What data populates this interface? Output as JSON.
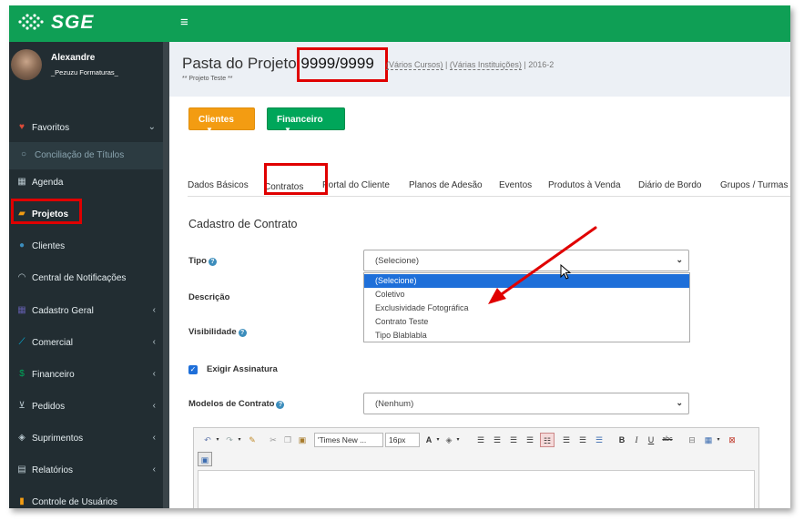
{
  "app": {
    "logo_text": "SGE",
    "menu_icon": "≡"
  },
  "user": {
    "name": "Alexandre",
    "org": "_Pezuzu Formaturas_"
  },
  "sidebar": {
    "items": [
      {
        "label": "Favoritos",
        "icon": "heart-icon",
        "glyph": "♥",
        "arrow": "⌄"
      },
      {
        "label": "Conciliação de Títulos",
        "icon": "circle-icon",
        "glyph": "○",
        "arrow": ""
      },
      {
        "label": "Agenda",
        "icon": "calendar-icon",
        "glyph": "▦",
        "arrow": ""
      },
      {
        "label": "Projetos",
        "icon": "folder-icon",
        "glyph": "▰",
        "arrow": ""
      },
      {
        "label": "Clientes",
        "icon": "user-icon",
        "glyph": "●",
        "arrow": ""
      },
      {
        "label": "Central de Notificações",
        "icon": "rss-icon",
        "glyph": "◠",
        "arrow": ""
      },
      {
        "label": "Cadastro Geral",
        "icon": "grid-icon",
        "glyph": "▦",
        "arrow": "‹"
      },
      {
        "label": "Comercial",
        "icon": "chart-icon",
        "glyph": "⟋",
        "arrow": "‹"
      },
      {
        "label": "Financeiro",
        "icon": "dollar-icon",
        "glyph": "$",
        "arrow": "‹"
      },
      {
        "label": "Pedidos",
        "icon": "cart-icon",
        "glyph": "⊻",
        "arrow": "‹"
      },
      {
        "label": "Suprimentos",
        "icon": "cubes-icon",
        "glyph": "◈",
        "arrow": "‹"
      },
      {
        "label": "Relatórios",
        "icon": "file-icon",
        "glyph": "▤",
        "arrow": "‹"
      },
      {
        "label": "Controle de Usuários",
        "icon": "lock-icon",
        "glyph": "▮",
        "arrow": ""
      }
    ]
  },
  "header": {
    "title_prefix": "Pasta do Projeto ",
    "project_code": "9999/9999",
    "link_courses": "(Vários Cursos)",
    "separator1": " | ",
    "link_institutions": "(Várias Instituições)",
    "separator2": " | ",
    "year": "2016-2",
    "subtitle": "** Projeto Teste **"
  },
  "buttons": {
    "clients": "Clientes",
    "finance": "Financeiro",
    "caret": "▼"
  },
  "tabs": [
    "Dados Básicos",
    "Contratos",
    "Portal do Cliente",
    "Planos de Adesão",
    "Eventos",
    "Produtos à Venda",
    "Diário de Bordo",
    "Grupos / Turmas"
  ],
  "form": {
    "section_title": "Cadastro de Contrato",
    "tipo_label": "Tipo",
    "tipo_value": "(Selecione)",
    "descricao_label": "Descrição",
    "visibilidade_label": "Visibilidade",
    "exigir_label": "Exigir Assinatura",
    "modelos_label": "Modelos de Contrato",
    "modelos_value": "(Nenhum)",
    "help_glyph": "?",
    "check_glyph": "✓",
    "chevron_glyph": "⌄"
  },
  "dropdown_options": [
    "(Selecione)",
    "Coletivo",
    "Exclusividade Fotográfica",
    "Contrato Teste",
    "Tipo Blablabla"
  ],
  "editor": {
    "font_family": "'Times New ...",
    "font_size": "16px"
  },
  "colors": {
    "topbar": "#0f9f55",
    "sidebar": "#222d32",
    "highlight": "#e00000",
    "orange": "#f39c12",
    "green": "#00a65a",
    "select_blue": "#1e6fd9"
  }
}
